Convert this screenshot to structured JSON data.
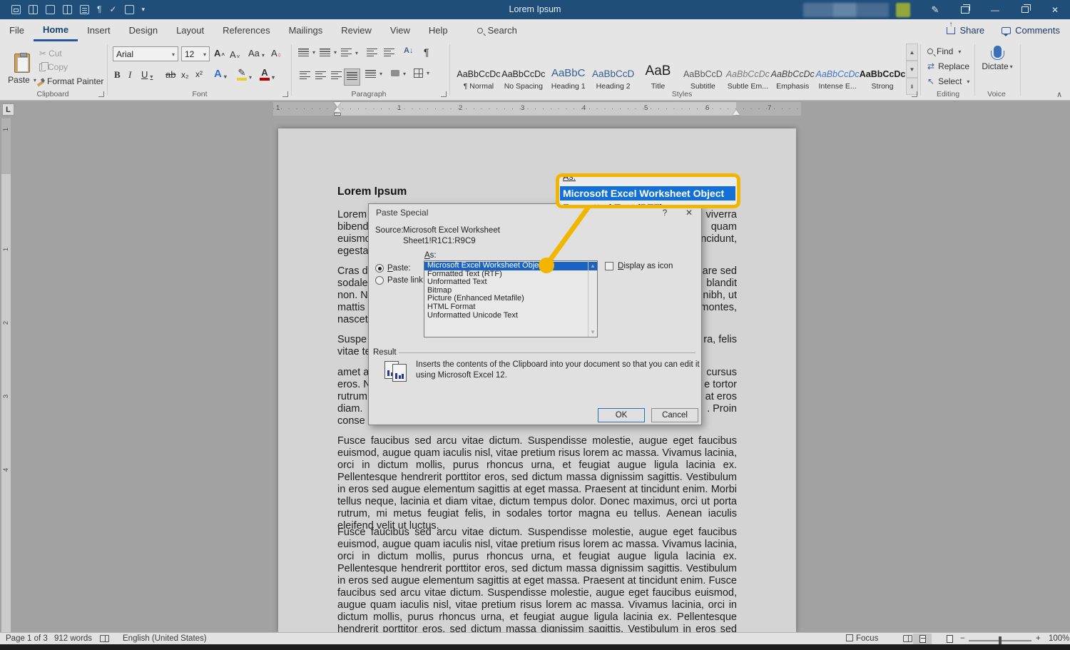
{
  "titlebar": {
    "title": "Lorem Ipsum",
    "minimize_glyph": "—",
    "close_glyph": "✕"
  },
  "tabs": {
    "items": [
      "File",
      "Home",
      "Insert",
      "Design",
      "Layout",
      "References",
      "Mailings",
      "Review",
      "View",
      "Help"
    ],
    "search": "Search",
    "share": "Share",
    "comments": "Comments"
  },
  "ribbon": {
    "clipboard": {
      "paste": "Paste",
      "cut": "Cut",
      "copy": "Copy",
      "format_painter": "Format Painter",
      "label": "Clipboard"
    },
    "font": {
      "family": "Arial",
      "size": "12",
      "grow": "A",
      "shrink": "A",
      "change_case": "Aa",
      "clear": "A",
      "bold": "B",
      "italic": "I",
      "underline": "U",
      "strikethrough": "ab",
      "subscript": "x₂",
      "superscript": "x²",
      "effects": "A",
      "highlight_pen": "✎",
      "color": "A",
      "label": "Font"
    },
    "paragraph": {
      "sort": "A↓",
      "pilcrow": "¶",
      "label": "Paragraph"
    },
    "styles": {
      "label": "Styles",
      "items": [
        {
          "preview": "AaBbCcDc",
          "name": "¶ Normal"
        },
        {
          "preview": "AaBbCcDc",
          "name": "No Spacing"
        },
        {
          "preview": "AaBbC",
          "name": "Heading 1"
        },
        {
          "preview": "AaBbCcD",
          "name": "Heading 2"
        },
        {
          "preview": "AaB",
          "name": "Title"
        },
        {
          "preview": "AaBbCcD",
          "name": "Subtitle"
        },
        {
          "preview": "AaBbCcDc",
          "name": "Subtle Em..."
        },
        {
          "preview": "AaBbCcDc",
          "name": "Emphasis"
        },
        {
          "preview": "AaBbCcDc",
          "name": "Intense E..."
        },
        {
          "preview": "AaBbCcDc",
          "name": "Strong"
        }
      ]
    },
    "editing": {
      "find": "Find",
      "replace": "Replace",
      "select": "Select",
      "label": "Editing"
    },
    "voice": {
      "dictate": "Dictate",
      "label": "Voice"
    }
  },
  "ruler": {
    "h": [
      "1",
      "1",
      "2",
      "3",
      "4",
      "5",
      "6",
      "7"
    ],
    "v": [
      "1",
      "1",
      "2",
      "3",
      "4"
    ],
    "tab_selector": "L"
  },
  "document": {
    "title": "Lorem Ipsum",
    "fragments": [
      {
        "left": "Lorem",
        "right": "viverra"
      },
      {
        "left": "bibend",
        "right": "quam"
      },
      {
        "left": "euismo",
        "right": "ncidunt,"
      },
      {
        "left": "egesta",
        "right": ""
      },
      {
        "left": "Cras d",
        "right": "are sed"
      },
      {
        "left": "sodale",
        "right": "blandit"
      },
      {
        "left": "non. N",
        "right": "nibh, ut"
      },
      {
        "left": "mattis",
        "right": "montes,"
      },
      {
        "left": "nascet",
        "right": ""
      },
      {
        "left": "Suspe",
        "right": "ra, felis"
      },
      {
        "left": "vitae te",
        "right": ""
      },
      {
        "left": "amet a",
        "right": "cursus"
      },
      {
        "left": "eros. N",
        "right": "e tortor"
      },
      {
        "left": "rutrum",
        "right": "at eros"
      },
      {
        "left": "diam. ",
        "right": ". Proin"
      },
      {
        "left": "conse",
        "right": ""
      }
    ],
    "paragraphs": [
      "Fusce faucibus sed arcu vitae dictum. Suspendisse molestie, augue eget faucibus euismod, augue quam iaculis nisl, vitae pretium risus lorem ac massa. Vivamus lacinia, orci in dictum mollis, purus rhoncus urna, et feugiat augue ligula lacinia ex. Pellentesque hendrerit porttitor eros, sed dictum massa dignissim sagittis. Vestibulum in eros sed augue elementum sagittis at eget massa. Praesent at tincidunt enim. Morbi tellus neque, lacinia et diam vitae, dictum tempus dolor. Donec maximus, orci ut porta rutrum, mi metus feugiat felis, in sodales tortor magna eu tellus. Aenean iaculis eleifend velit ut luctus.",
      "Fusce faucibus sed arcu vitae dictum. Suspendisse molestie, augue eget faucibus euismod, augue quam iaculis nisl, vitae pretium risus lorem ac massa. Vivamus lacinia, orci in dictum mollis, purus rhoncus urna, et feugiat augue ligula lacinia ex. Pellentesque hendrerit porttitor eros, sed dictum massa dignissim sagittis. Vestibulum in eros sed augue elementum sagittis at eget massa. Praesent at tincidunt enim. Fusce faucibus sed arcu vitae dictum. Suspendisse molestie, augue eget faucibus euismod, augue quam iaculis nisl, vitae pretium risus lorem ac massa. Vivamus lacinia, orci in dictum mollis, purus rhoncus urna, et feugiat augue ligula lacinia ex. Pellentesque hendrerit porttitor eros, sed dictum massa dignissim sagittis. Vestibulum in eros sed augue elementum"
    ]
  },
  "dialog": {
    "title": "Paste Special",
    "help_glyph": "?",
    "close_glyph": "✕",
    "source_label": "Source:",
    "source_name": "Microsoft Excel Worksheet",
    "source_range": "Sheet1!R1C1:R9C9",
    "paste_label": "Paste:",
    "paste_link_label": "Paste link:",
    "as_label": "As:",
    "list": [
      "Microsoft Excel Worksheet Object",
      "Formatted Text (RTF)",
      "Unformatted Text",
      "Bitmap",
      "Picture (Enhanced Metafile)",
      "HTML Format",
      "Unformatted Unicode Text"
    ],
    "selected_index": 0,
    "display_as_icon_label": "Display as icon",
    "result_label": "Result",
    "result_text": "Inserts the contents of the Clipboard into your document so that you can edit it using Microsoft Excel 12.",
    "ok_label": "OK",
    "cancel_label": "Cancel"
  },
  "callout": {
    "as_label": "As:",
    "selected": "Microsoft Excel Worksheet Object",
    "next_item": "Formatted Text (RTF)",
    "accent": "#f2b600"
  },
  "statusbar": {
    "page": "Page 1 of 3",
    "words": "912 words",
    "language": "English (United States)",
    "focus": "Focus",
    "zoom_out": "−",
    "zoom_in": "+",
    "zoom": "100%"
  },
  "colors": {
    "titlebar": "#1f4e79",
    "accent": "#2b579a",
    "selection": "#1a63c4",
    "callout": "#f2b600"
  }
}
